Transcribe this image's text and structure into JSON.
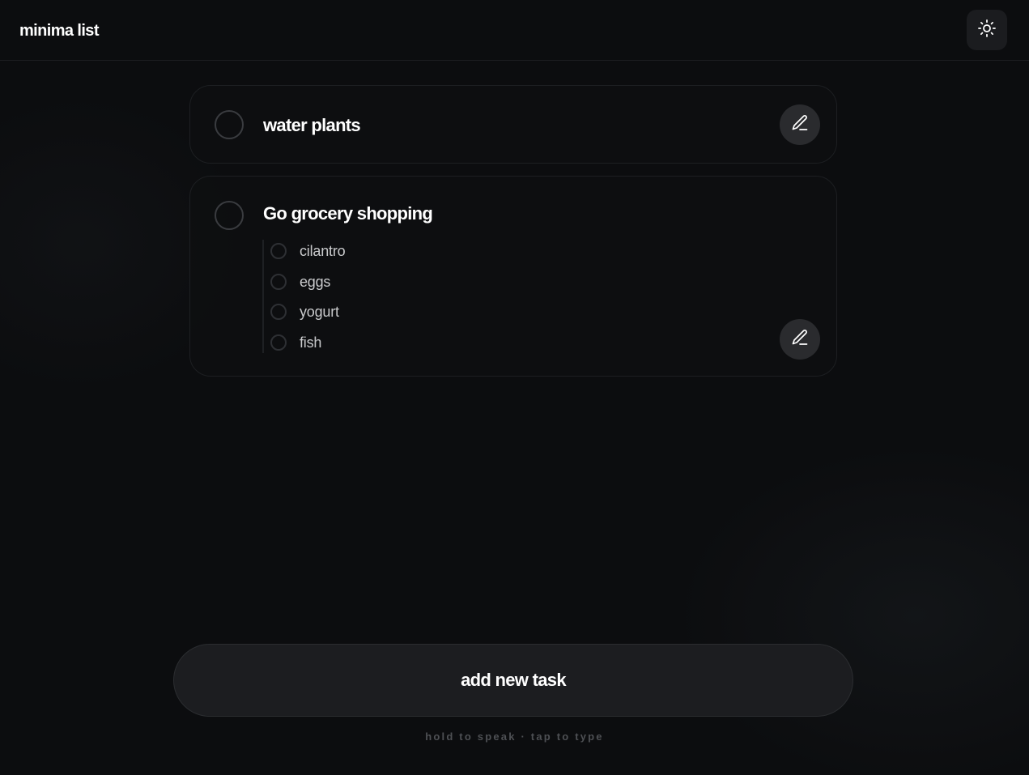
{
  "app": {
    "title": "minima list"
  },
  "header": {
    "theme_toggle_icon": "sun-icon"
  },
  "tasks": [
    {
      "title": "water plants",
      "done": false,
      "subtasks": []
    },
    {
      "title": "Go grocery shopping",
      "done": false,
      "subtasks": [
        {
          "label": "cilantro",
          "done": false
        },
        {
          "label": "eggs",
          "done": false
        },
        {
          "label": "yogurt",
          "done": false
        },
        {
          "label": "fish",
          "done": false
        }
      ]
    }
  ],
  "icons": {
    "edit": "pencil-icon",
    "theme": "sun-icon"
  },
  "footer": {
    "add_label": "add new task",
    "hint": "hold to speak · tap to type"
  },
  "colors": {
    "background": "#0c0d0f",
    "card_border": "#1d1f22",
    "button_bg": "#1c1d20",
    "text_primary": "#ffffff",
    "text_muted": "#4e5054"
  }
}
